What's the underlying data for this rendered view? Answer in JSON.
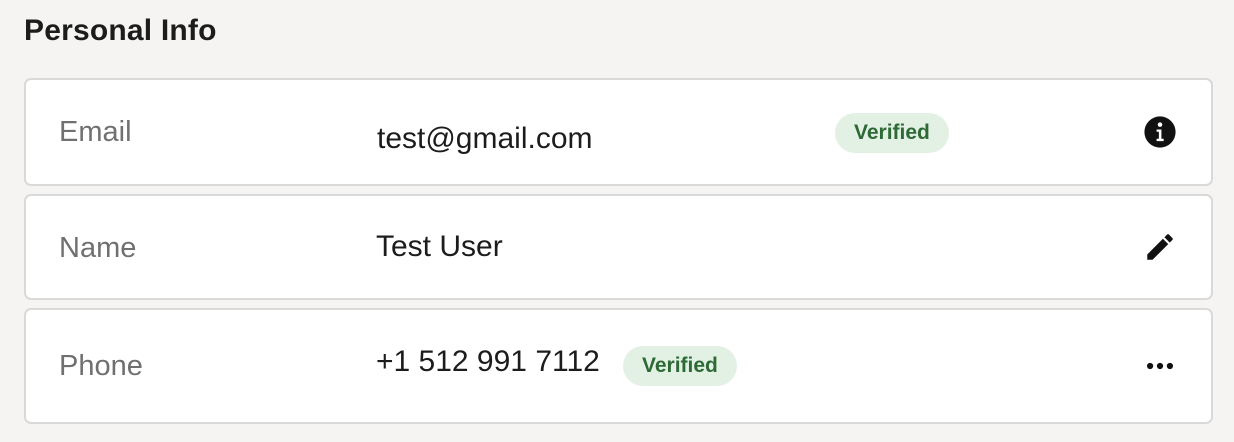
{
  "section": {
    "title": "Personal Info"
  },
  "rows": {
    "email": {
      "label": "Email",
      "value": "test@gmail.com",
      "badge": "Verified",
      "action_icon": "info-icon"
    },
    "name": {
      "label": "Name",
      "value": "Test User",
      "action_icon": "pencil-icon"
    },
    "phone": {
      "label": "Phone",
      "value": "+1 512 991 7112",
      "badge": "Verified",
      "action_icon": "more-horizontal-icon"
    }
  },
  "colors": {
    "background": "#f5f4f2",
    "card": "#ffffff",
    "border": "#d9d9d9",
    "label": "#707070",
    "text": "#1c1c1c",
    "badge_bg": "#e3f1e5",
    "badge_text": "#2e6a36"
  }
}
